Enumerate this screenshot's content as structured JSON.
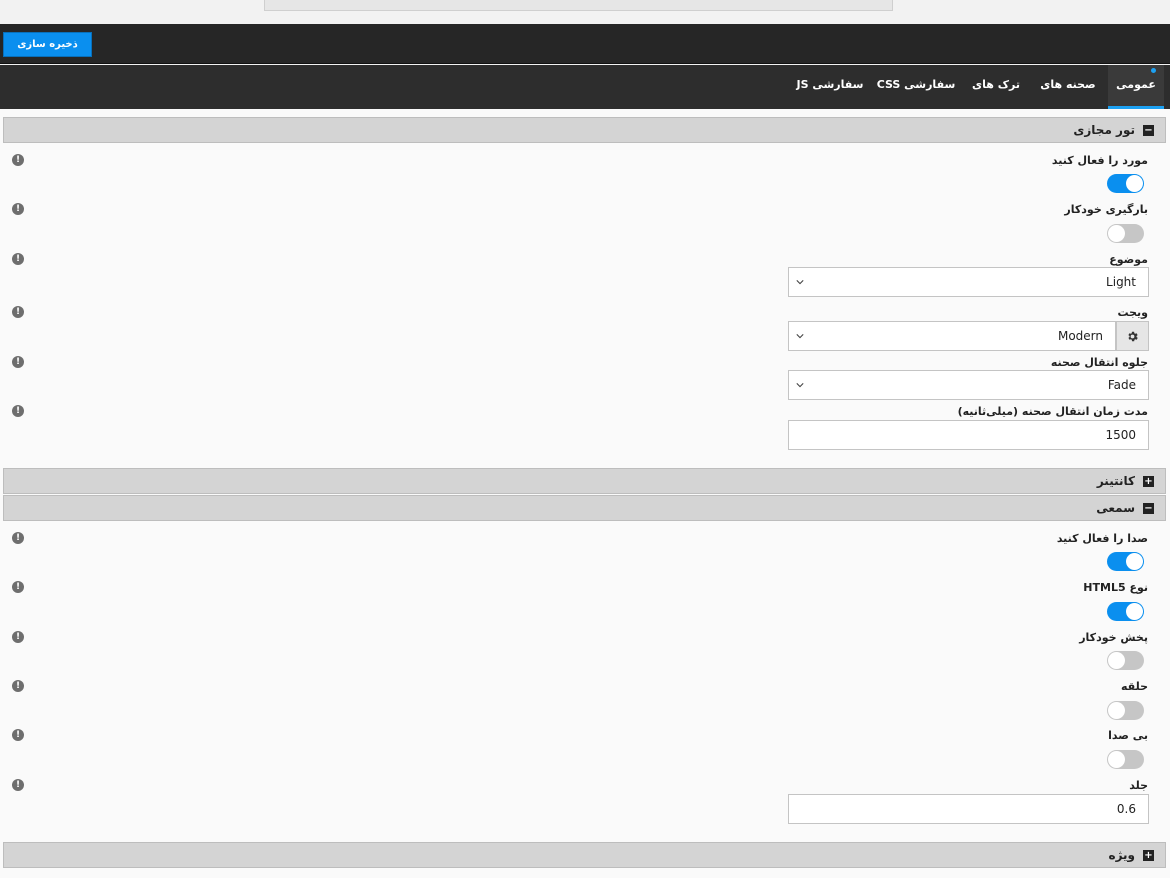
{
  "toolbar": {
    "save_label": "ذخیره سازی"
  },
  "tabs": [
    {
      "label": "عمومی"
    },
    {
      "label": "صحنه های"
    },
    {
      "label": "ترک های"
    },
    {
      "label": "CSS سفارشی"
    },
    {
      "label": "JS سفارشی"
    }
  ],
  "sections": {
    "virtual_tour": {
      "title": "تور مجازی",
      "enable_label": "مورد را فعال کنید",
      "enable_on": true,
      "autoload_label": "بارگیری خودکار",
      "autoload_on": false,
      "theme_label": "موضوع",
      "theme_value": "Light",
      "widget_label": "ویجت",
      "widget_value": "Modern",
      "transition_label": "جلوه انتقال صحنه",
      "transition_value": "Fade",
      "duration_label": "مدت زمان انتقال صحنه (میلی‌ثانیه)",
      "duration_value": "1500"
    },
    "container": {
      "title": "کانتینر"
    },
    "audio": {
      "title": "سمعی",
      "enable_label": "صدا را فعال کنید",
      "enable_on": true,
      "html5_label": "نوع HTML5",
      "html5_on": true,
      "autoplay_label": "پخش خودکار",
      "autoplay_on": false,
      "loop_label": "حلقه",
      "loop_on": false,
      "mute_label": "بی صدا",
      "mute_on": false,
      "volume_label": "جلد",
      "volume_value": "0.6"
    },
    "special": {
      "title": "ویژه"
    }
  },
  "colors": {
    "accent": "#0a8fef",
    "tab_underline": "#1da1f2",
    "dark_bar": "#262626"
  },
  "icons": {
    "info": "info-icon",
    "expand": "plus-square-icon",
    "collapse": "minus-square-icon",
    "gear": "gear-icon",
    "chevron": "chevron-down-icon"
  }
}
